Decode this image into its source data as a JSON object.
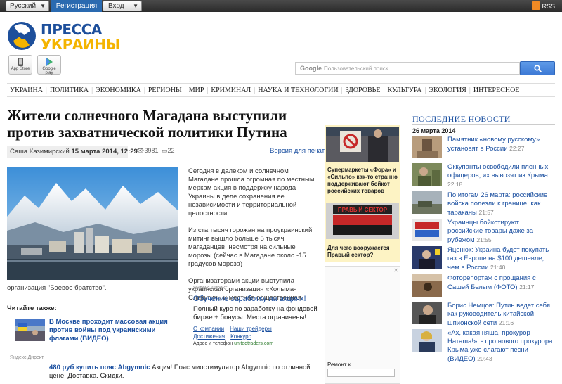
{
  "topbar": {
    "language": "Русский",
    "register": "Регистрация",
    "login": "Вход",
    "rss": "RSS"
  },
  "header": {
    "logo_line1": "ПРЕССА",
    "logo_line2": "УКРАИНЫ",
    "appstore": "App Store",
    "googleplay": "Google play",
    "search_brand": "Google",
    "search_placeholder": "Пользовательский поиск"
  },
  "nav": [
    "УКРАИНА",
    "ПОЛИТИКА",
    "ЭКОНОМИКА",
    "РЕГИОНЫ",
    "МИР",
    "КРИМИНАЛ",
    "НАУКА И ТЕХНОЛОГИИ",
    "ЗДОРОВЬЕ",
    "КУЛЬТУРА",
    "ЭКОЛОГИЯ",
    "ИНТЕРЕСНОЕ"
  ],
  "article": {
    "title": "Жители солнечного Магадана выступили против захватнической политики Путина",
    "author": "Саша Казимирский",
    "date": "15 марта 2014, 12:29",
    "views": "3981",
    "comments": "22",
    "print": "Версия для печати",
    "paragraphs": [
      "Сегодня в далеком и солнечном Магадане прошла огромная по местным меркам акция в поддержку народа Украины в деле сохранения ее независимости и территориальной целостности.",
      "Из ста тысяч горожан на проукраинский митинг вышло больше 5 тысяч магаданцев, несмотря на сильные морозы (сейчас в Магадане около -15 градусов мороза)",
      "Организаторами акции выступила украинская организация «Колыма-Славутич» и местная общественная"
    ],
    "caption": "организация \"Боевое братство\"."
  },
  "direct": {
    "label": "Яндекс.Директ",
    "title": "Обучение заработку на акциях!",
    "text": "Полный курс по заработку на фондовой бирже + бонусы. Места ограничены!",
    "link1": "О компании",
    "link2": "Наши трейдеры",
    "link3": "Достижения",
    "link4": "Конкурс",
    "address_label": "Адрес и телефон",
    "domain": "unitedtraders.com"
  },
  "see_also": {
    "heading": "Читайте также:",
    "link": "В Москве проходит массовая акция против войны под украинскими флагами (ВИДЕО)"
  },
  "ad2": {
    "label": "Яндекс.Директ",
    "title": "480 руб купить пояс Abgymnic",
    "text": "Акция! Пояс миостимулятор Abgymnic по отличной цене. Доставка. Скидки."
  },
  "mid": {
    "item1": "Супермаркеты «Фора» и «Сильпо» как-то странно поддерживают бойкот российских товаров",
    "item2_sign": "ПРАВЫЙ СЕКТОР",
    "item2": "Для чего вооружается Правый сектор?",
    "ad_close": "✕",
    "remont": "Ремонт к"
  },
  "news": {
    "heading": "ПОСЛЕДНИЕ НОВОСТИ",
    "date": "26 марта 2014",
    "items": [
      {
        "text": "Памятник «новому русскому» установят в России",
        "time": "22:27"
      },
      {
        "text": "Оккупанты освободили пленных офицеров, их вывозят из Крыма",
        "time": "22:18"
      },
      {
        "text": "По итогам 26 марта: российские войска полезли к границе, как тараканы",
        "time": "21:57"
      },
      {
        "text": "Украинцы бойкотируют российские товары даже за рубежом",
        "time": "21:55"
      },
      {
        "text": "Яценюк: Украина будет покупать газ в Европе на $100 дешевле, чем в России",
        "time": "21:40"
      },
      {
        "text": "Фоторепортаж с прощания с Сашей Белым (ФОТО)",
        "time": "21:17"
      },
      {
        "text": "Борис Немцов: Путин ведет себя как руководитель китайской шпионской сети",
        "time": "21:16"
      },
      {
        "text": "«Ах, какая няша, прокурор Наташа!», - про нового прокурора Крыма уже слагают песни (ВИДЕО)",
        "time": "20:43"
      }
    ]
  },
  "colors": {
    "link": "#1a4fa0",
    "logo_blue": "#1d4f9b",
    "logo_yellow": "#f4b400",
    "topbar": "#2b2b2b",
    "register": "#2a6ab0",
    "mid_bg": "#fdf3c4"
  }
}
